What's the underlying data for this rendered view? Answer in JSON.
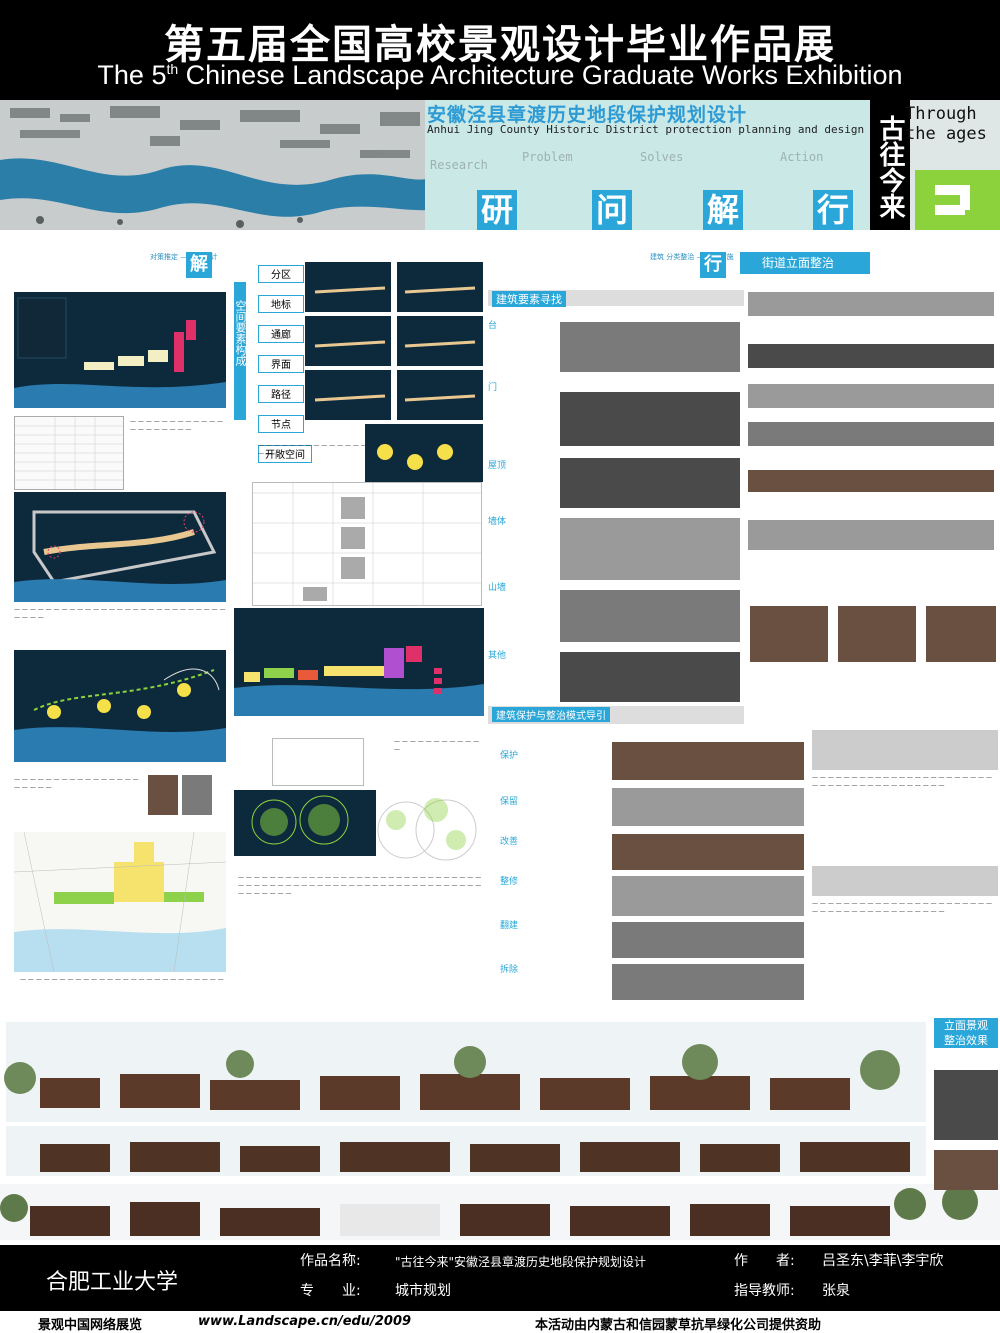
{
  "header": {
    "title_cn": "第五届全国高校景观设计毕业作品展",
    "title_en_pre": "The 5",
    "title_en_sup": "th",
    "title_en_post": " Chinese Landscape Architecture Graduate Works Exhibition"
  },
  "banner": {
    "project_cn": "安徽泾县章渡历史地段保护规划设计",
    "project_en": "Anhui Jing County Historic District protection planning and design",
    "ghost_words": [
      "Research",
      "Problem",
      "Solves",
      "Action"
    ],
    "big_chars": [
      "研",
      "问",
      "解",
      "行"
    ],
    "vertical_title": "古往今来",
    "through": [
      "Through",
      "the ages"
    ]
  },
  "sections": {
    "solve_label": "解",
    "act_label": "行",
    "elevation_heading": "街道立面整治",
    "space_heading": "空间要素构成",
    "space_items": [
      "分区",
      "地标",
      "通廊",
      "界面",
      "路径",
      "节点",
      "开敞空间"
    ],
    "building_heading": "建筑要素寻找",
    "protect_heading": "建筑保护与整治模式导引",
    "protect_items": [
      "保护",
      "保留",
      "改善",
      "整修",
      "翻建",
      "拆除"
    ],
    "element_items": [
      "台",
      "门",
      "屋顶",
      "墙体",
      "山墙",
      "其他"
    ],
    "elev_result": [
      "立面景观",
      "整治效果"
    ]
  },
  "footer": {
    "school": "合肥工业大学",
    "work_label": "作品名称:",
    "work_name": "\"古往今来\"安徽泾县章渡历史地段保护规划设计",
    "major_label": "专　　业:",
    "major": "城市规划",
    "author_label": "作　　者:",
    "authors": "吕圣东\\李菲\\李宇欣",
    "advisor_label": "指导教师:",
    "advisor": "张泉",
    "site_label": "景观中国网络展览",
    "site_url": "www.Landscape.cn/edu/2009",
    "sponsor": "本活动由内蒙古和信园蒙草抗旱绿化公司提供资助"
  },
  "colors": {
    "accent": "#2aa7d8",
    "green": "#8bd23c",
    "dark_panel": "#0d2a3c"
  }
}
